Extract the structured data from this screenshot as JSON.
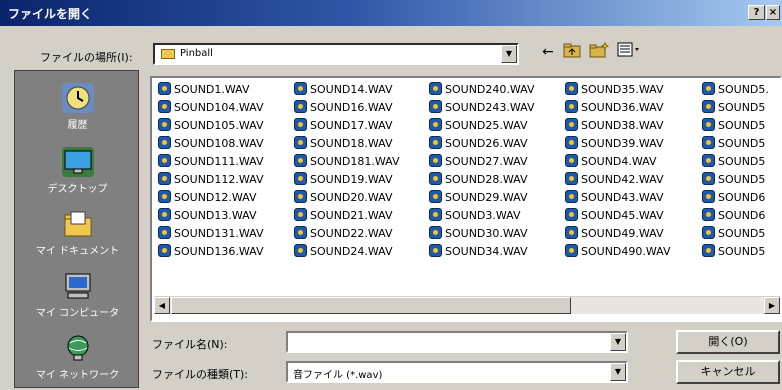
{
  "window": {
    "title": "ファイルを開く",
    "help_label": "?",
    "close_label": "×"
  },
  "lookin": {
    "label": "ファイルの場所(I):",
    "value": "Pinball"
  },
  "toolbar": {
    "back_icon": "back-arrow-icon",
    "up_icon": "up-folder-icon",
    "newfolder_icon": "new-folder-icon",
    "views_icon": "view-menu-icon"
  },
  "places": [
    {
      "label": "履歴",
      "icon": "history-icon"
    },
    {
      "label": "デスクトップ",
      "icon": "desktop-icon"
    },
    {
      "label": "マイ ドキュメント",
      "icon": "my-documents-icon"
    },
    {
      "label": "マイ コンピュータ",
      "icon": "my-computer-icon"
    },
    {
      "label": "マイ ネットワーク",
      "icon": "network-icon"
    }
  ],
  "files": {
    "columns": [
      [
        "SOUND1.WAV",
        "SOUND104.WAV",
        "SOUND105.WAV",
        "SOUND108.WAV",
        "SOUND111.WAV",
        "SOUND112.WAV",
        "SOUND12.WAV",
        "SOUND13.WAV",
        "SOUND131.WAV",
        "SOUND136.WAV"
      ],
      [
        "SOUND14.WAV",
        "SOUND16.WAV",
        "SOUND17.WAV",
        "SOUND18.WAV",
        "SOUND181.WAV",
        "SOUND19.WAV",
        "SOUND20.WAV",
        "SOUND21.WAV",
        "SOUND22.WAV",
        "SOUND24.WAV"
      ],
      [
        "SOUND240.WAV",
        "SOUND243.WAV",
        "SOUND25.WAV",
        "SOUND26.WAV",
        "SOUND27.WAV",
        "SOUND28.WAV",
        "SOUND29.WAV",
        "SOUND3.WAV",
        "SOUND30.WAV",
        "SOUND34.WAV"
      ],
      [
        "SOUND35.WAV",
        "SOUND36.WAV",
        "SOUND38.WAV",
        "SOUND39.WAV",
        "SOUND4.WAV",
        "SOUND42.WAV",
        "SOUND43.WAV",
        "SOUND45.WAV",
        "SOUND49.WAV",
        "SOUND490.WAV"
      ],
      [
        "SOUND5.",
        "SOUND5",
        "SOUND5",
        "SOUND5",
        "SOUND5",
        "SOUND5",
        "SOUND6",
        "SOUND6",
        "SOUND5",
        "SOUND5"
      ]
    ]
  },
  "filename": {
    "label": "ファイル名(N):",
    "value": ""
  },
  "filetype": {
    "label": "ファイルの種類(T):",
    "value": "音ファイル (*.wav)"
  },
  "buttons": {
    "open": "開く(O)",
    "cancel": "キャンセル"
  }
}
